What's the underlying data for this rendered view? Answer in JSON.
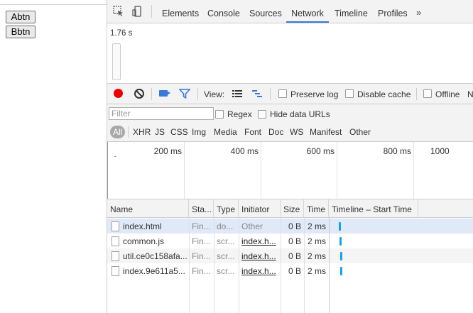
{
  "page": {
    "buttons": [
      "Abtn",
      "Bbtn"
    ]
  },
  "devtools": {
    "tabs": [
      "Elements",
      "Console",
      "Sources",
      "Network",
      "Timeline",
      "Profiles"
    ],
    "active_tab": "Network",
    "more_tabs": "»",
    "overview": {
      "duration": "1.76 s"
    },
    "toolbar": {
      "view_label": "View:",
      "preserve_log": "Preserve log",
      "disable_cache": "Disable cache",
      "offline": "Offline",
      "clipped": "N"
    },
    "filter": {
      "placeholder": "Filter",
      "regex": "Regex",
      "hide_data_urls": "Hide data URLs"
    },
    "types": [
      "All",
      "XHR",
      "JS",
      "CSS",
      "Img",
      "Media",
      "Font",
      "Doc",
      "WS",
      "Manifest",
      "Other"
    ],
    "selected_type": "All",
    "timeline_ticks": [
      "200 ms",
      "400 ms",
      "600 ms",
      "800 ms",
      "1000"
    ],
    "columns": [
      "Name",
      "Sta...",
      "Type",
      "Initiator",
      "Size",
      "Time",
      "Timeline – Start Time"
    ],
    "rows": [
      {
        "name": "index.html",
        "status": "Fin...",
        "type": "do...",
        "initiator": "Other",
        "size": "0 B",
        "time": "2 ms"
      },
      {
        "name": "common.js",
        "status": "Fin...",
        "type": "scr...",
        "initiator": "index.h...",
        "size": "0 B",
        "time": "2 ms"
      },
      {
        "name": "util.ce0c158afa...",
        "status": "Fin...",
        "type": "scr...",
        "initiator": "index.h...",
        "size": "0 B",
        "time": "2 ms"
      },
      {
        "name": "index.9e611a5...",
        "status": "Fin...",
        "type": "scr...",
        "initiator": "index.h...",
        "size": "0 B",
        "time": "2 ms"
      }
    ],
    "colors": {
      "accent": "#3879d9",
      "record": "#ee0000",
      "waterfall": "#10a4e8",
      "selected_row": "#dfe9f8"
    }
  }
}
